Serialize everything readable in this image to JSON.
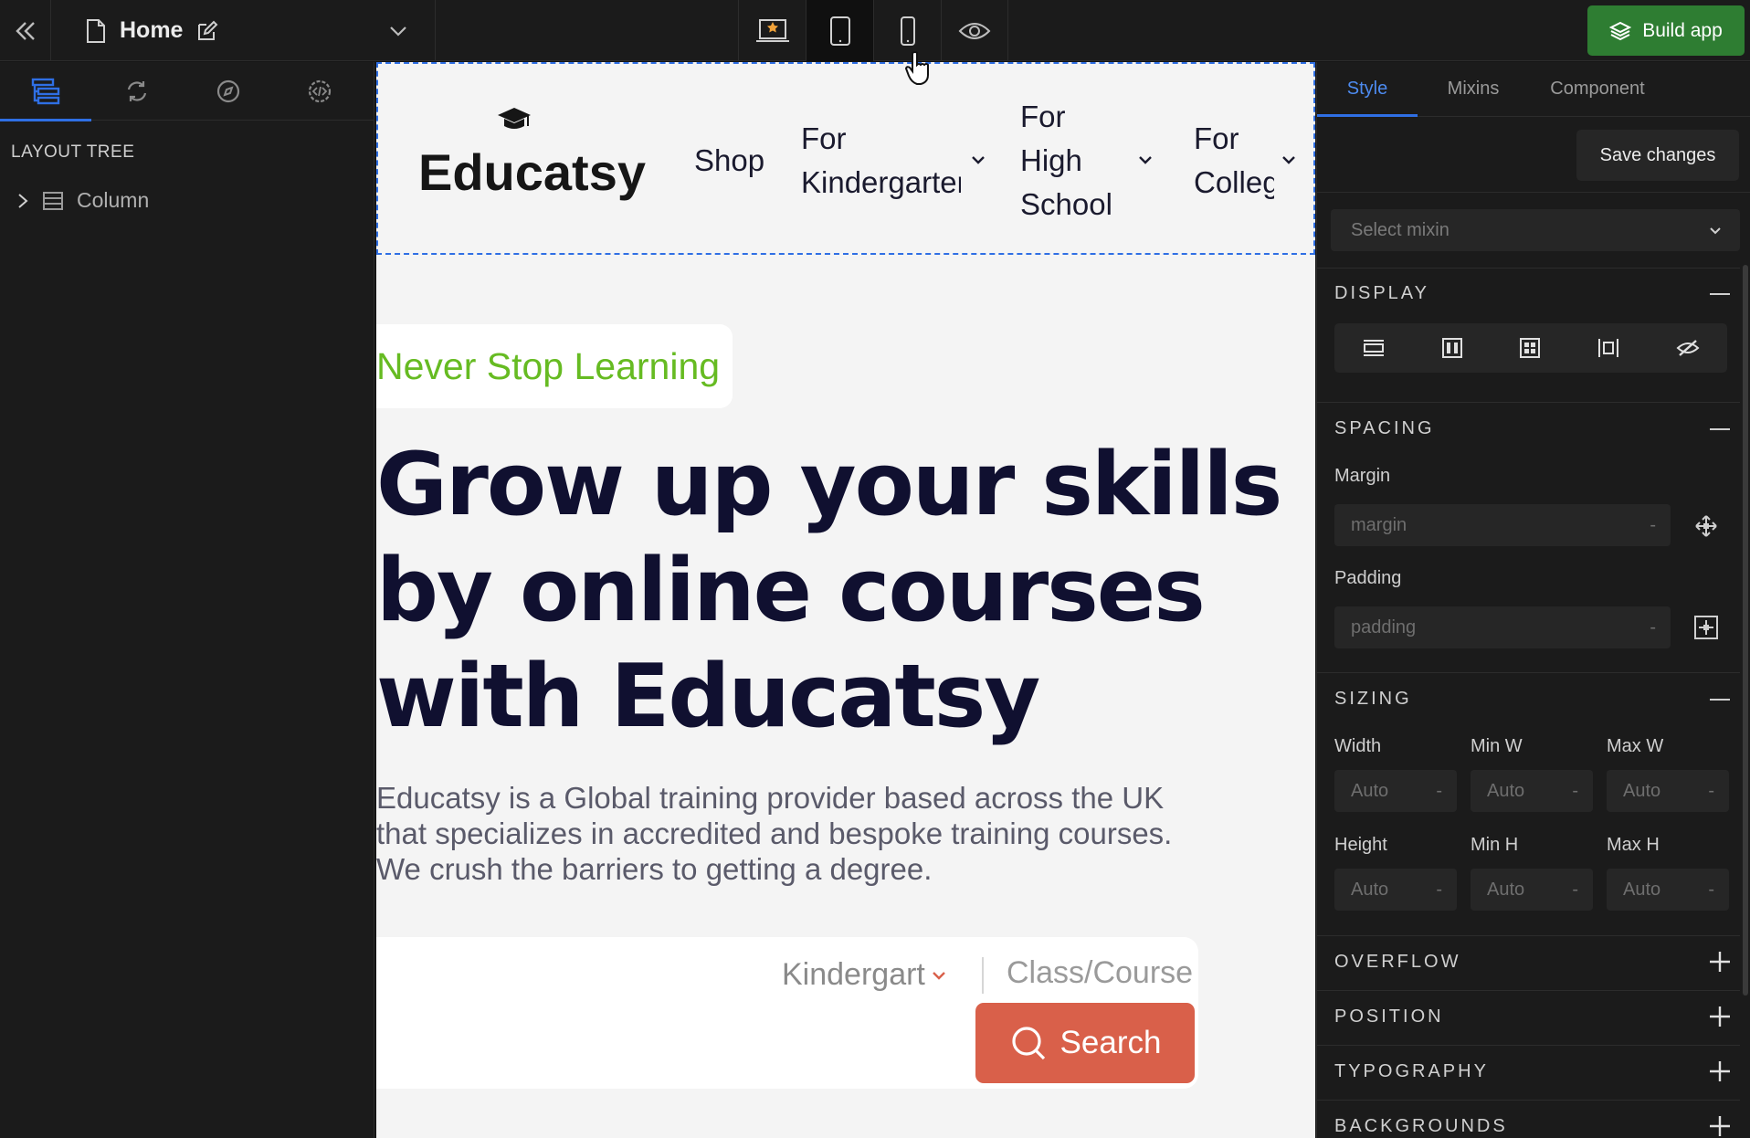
{
  "topbar": {
    "page_name": "Home",
    "build_label": "Build app"
  },
  "left_panel": {
    "tree_title": "LAYOUT TREE",
    "tree_items": [
      {
        "label": "Column"
      }
    ]
  },
  "canvas": {
    "brand": "Educatsy",
    "nav": {
      "shop": "Shop",
      "kindergarten_1": "For",
      "kindergarten_2": "Kindergarten",
      "high_school_1": "For",
      "high_school_2": "High",
      "high_school_3": "School",
      "college_1": "For",
      "college_2": "College"
    },
    "tagline": "Never Stop Learning",
    "hero_line1": "Grow up your skills",
    "hero_line2": "by online courses",
    "hero_line3": "with Educatsy",
    "description": "Educatsy is a Global training provider based across the UK that specializes in accredited and bespoke training courses. We crush the barriers to getting a degree.",
    "search": {
      "dropdown_value": "Kindergart",
      "class_placeholder": "Class/Course",
      "button_label": "Search"
    },
    "colors": {
      "tagline": "#66bb22",
      "search_button": "#d9604a",
      "hero_text": "#101030"
    }
  },
  "right_panel": {
    "tabs": {
      "style": "Style",
      "mixins": "Mixins",
      "component": "Component"
    },
    "save_label": "Save changes",
    "mixin_placeholder": "Select mixin",
    "sections": {
      "display": "DISPLAY",
      "spacing": "SPACING",
      "sizing": "SIZING",
      "overflow": "OVERFLOW",
      "position": "POSITION",
      "typography": "TYPOGRAPHY",
      "backgrounds": "BACKGROUNDS"
    },
    "spacing": {
      "margin_label": "Margin",
      "margin_placeholder": "margin",
      "padding_label": "Padding",
      "padding_placeholder": "padding",
      "dash": "-"
    },
    "sizing": {
      "width": "Width",
      "min_w": "Min W",
      "max_w": "Max W",
      "height": "Height",
      "min_h": "Min H",
      "max_h": "Max H",
      "auto": "Auto",
      "dash": "-"
    },
    "colors": {
      "accent": "#2f6fe4",
      "build": "#2e7d32"
    }
  }
}
